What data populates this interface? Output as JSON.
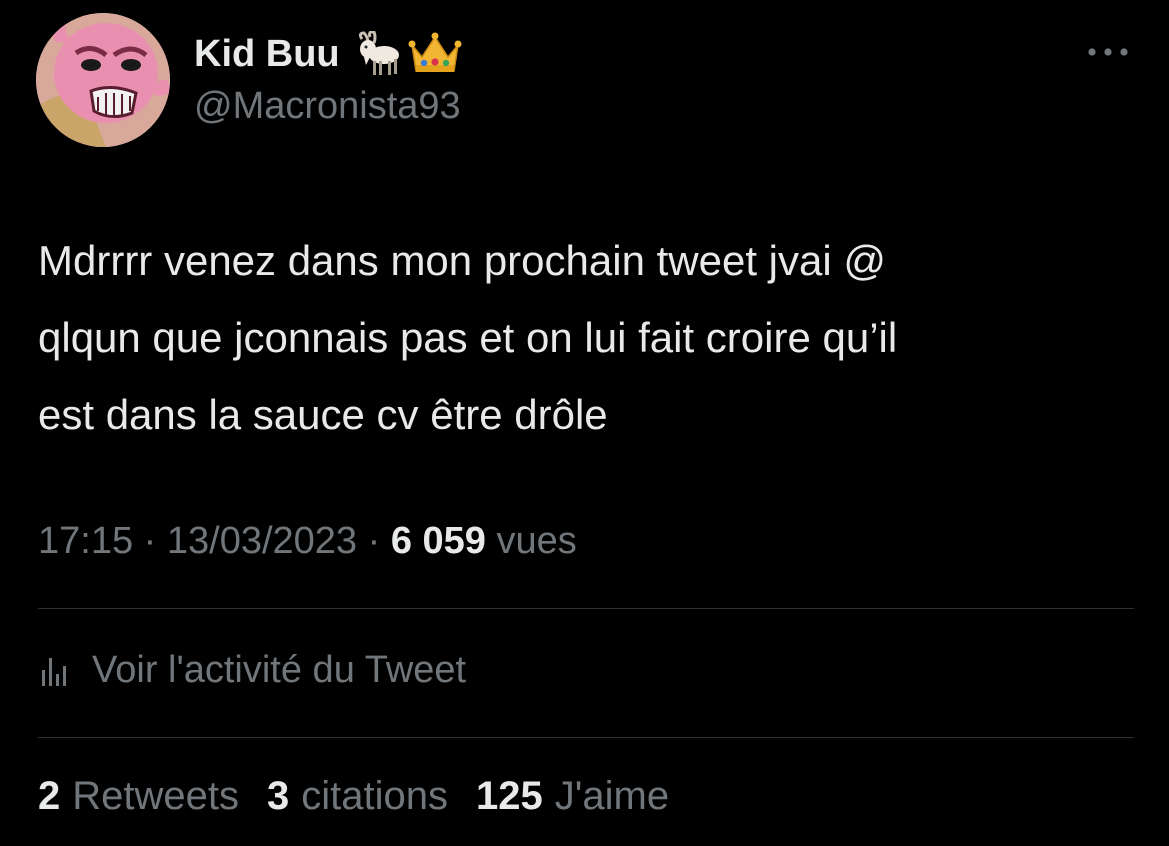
{
  "author": {
    "display_name": "Kid Buu",
    "handle": "@Macronista93",
    "name_emojis": [
      "goat-emoji",
      "crown-emoji"
    ],
    "avatar": "kid-buu-avatar"
  },
  "tweet": {
    "text": "Mdrrrr venez dans mon prochain tweet jvai @\nqlqun que jconnais pas et on lui fait croire qu’il\nest dans la sauce cv être drôle",
    "time": "17:15",
    "separator": "·",
    "date": "13/03/2023",
    "views_count": "6 059",
    "views_label": "vues"
  },
  "activity": {
    "icon": "analytics-bars-icon",
    "label": "Voir l'activité du Tweet"
  },
  "stats": {
    "retweets_count": "2",
    "retweets_label": "Retweets",
    "quotes_count": "3",
    "quotes_label": "citations",
    "likes_count": "125",
    "likes_label": "J'aime"
  },
  "colors": {
    "background": "#000000",
    "primary_text": "#e7e9ea",
    "secondary_text": "#71767b",
    "divider": "#2f3336"
  }
}
